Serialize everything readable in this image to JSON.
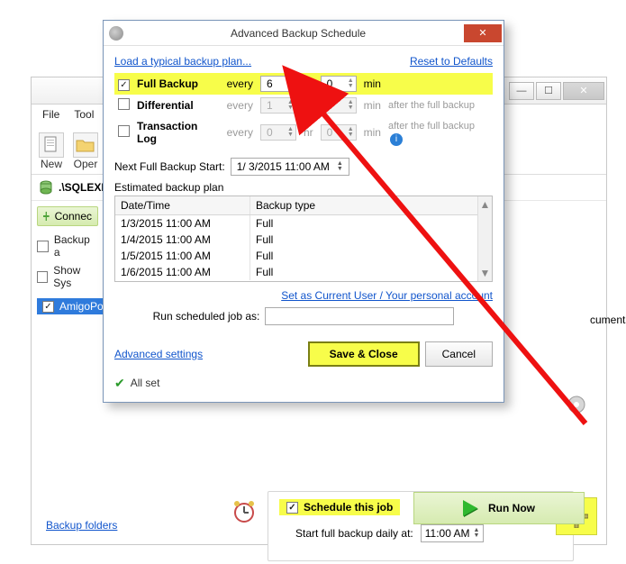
{
  "main": {
    "minimize_glyph": "—",
    "maximize_glyph": "☐",
    "close_glyph": "✕",
    "menu": {
      "file": "File",
      "tools": "Tool"
    },
    "toolbar": {
      "new": "New",
      "open": "Oper"
    },
    "server": ".\\SQLEXPI",
    "connect_button": "Connec",
    "backup_all": "Backup a",
    "show_sys": "Show Sys",
    "db_selected": "AmigoPos",
    "documents_label": "cuments\\",
    "schedule": {
      "checkbox_label": "Schedule this job",
      "start_label": "Start full backup daily at:",
      "time": "11:00 AM"
    },
    "run_now": "Run Now",
    "backup_folders": "Backup folders"
  },
  "dialog": {
    "title": "Advanced Backup Schedule",
    "close_glyph": "✕",
    "load_plan": "Load a typical backup plan...",
    "reset_defaults": "Reset to Defaults",
    "rows": {
      "full": {
        "label": "Full Backup",
        "every": "every",
        "hr_val": "6",
        "hr_unit": "hr",
        "min_val": "0",
        "min_unit": "min"
      },
      "diff": {
        "label": "Differential",
        "every": "every",
        "hr_val": "1",
        "min_val": "0",
        "min_unit": "min",
        "note": "after the full backup"
      },
      "tlog": {
        "label": "Transaction Log",
        "every": "every",
        "hr_val": "0",
        "hr_unit": "hr",
        "min_val": "0",
        "min_unit": "min",
        "note": "after the full backup"
      }
    },
    "next_label": "Next Full Backup Start:",
    "next_value": "1/  3/2015 11:00 AM",
    "plan_label": "Estimated backup plan",
    "plan_headers": {
      "dt": "Date/Time",
      "type": "Backup type"
    },
    "plan_rows": [
      {
        "dt": "1/3/2015 11:00 AM",
        "type": "Full"
      },
      {
        "dt": "1/4/2015 11:00 AM",
        "type": "Full"
      },
      {
        "dt": "1/5/2015 11:00 AM",
        "type": "Full"
      },
      {
        "dt": "1/6/2015 11:00 AM",
        "type": "Full"
      }
    ],
    "set_user": "Set as Current User / Your personal account",
    "run_as_label": "Run scheduled job as:",
    "run_as_value": "",
    "advanced": "Advanced settings",
    "save": "Save & Close",
    "cancel": "Cancel",
    "all_set": "All set"
  },
  "highlight_color": "#f7fd4a"
}
